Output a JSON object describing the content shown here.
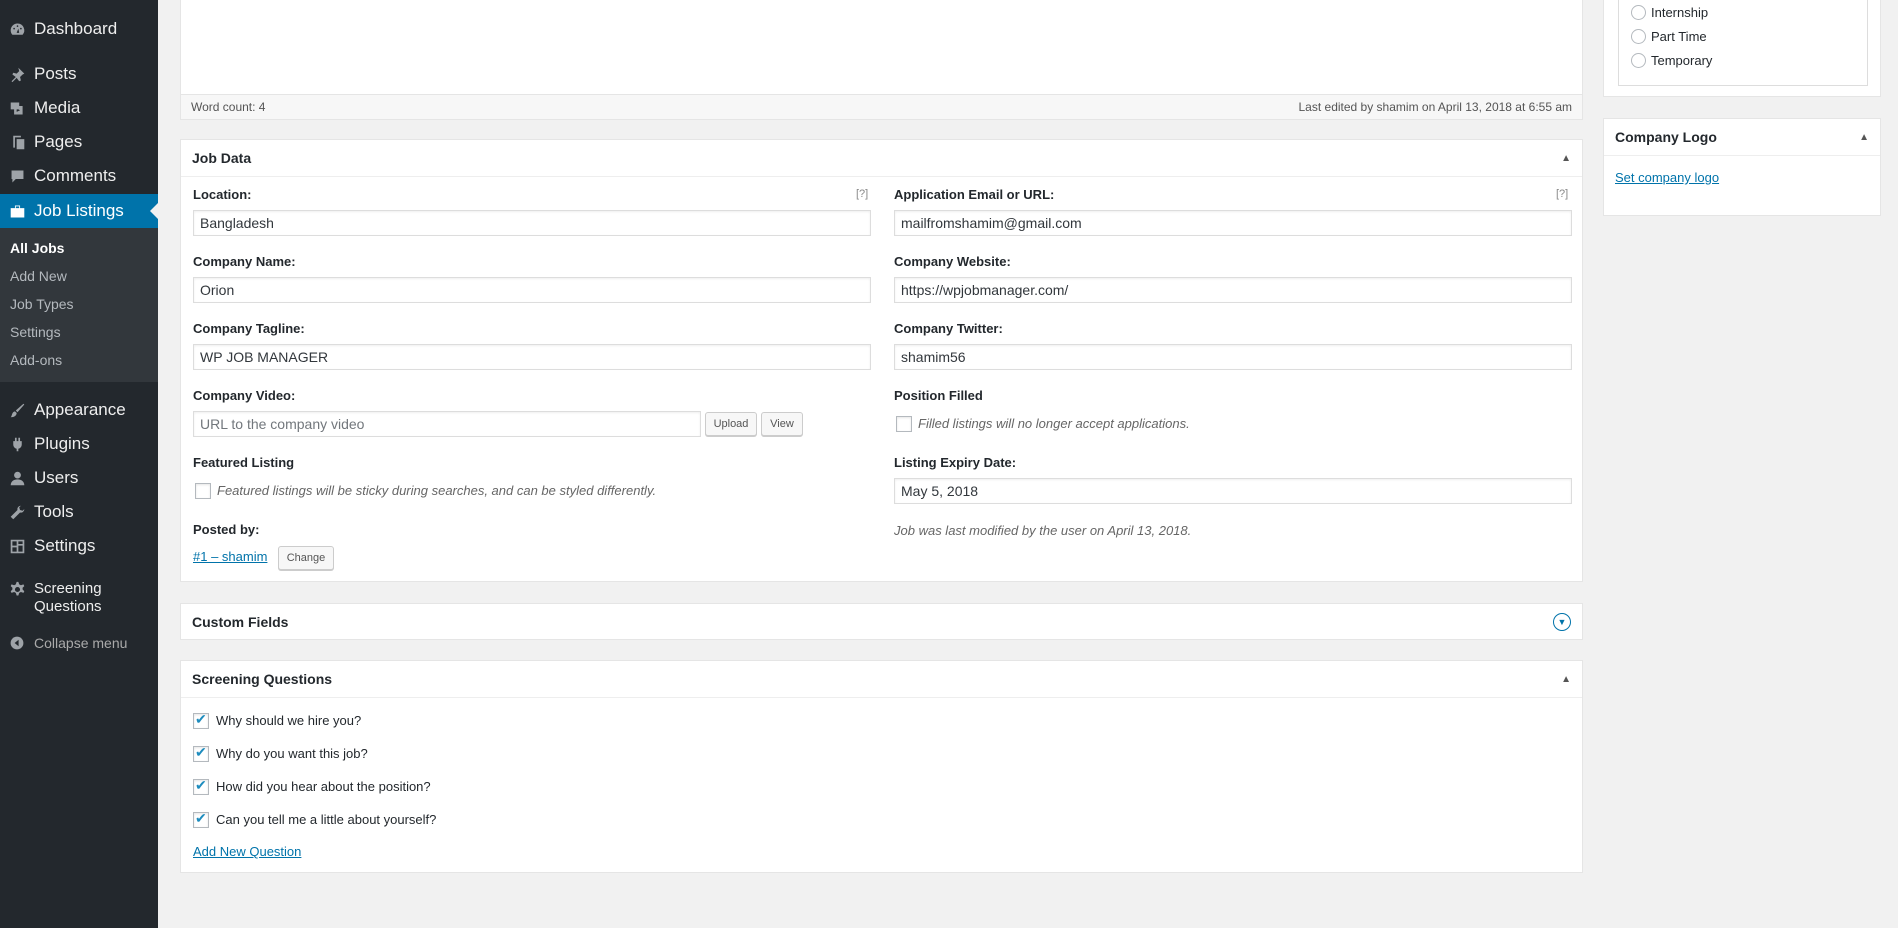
{
  "sidebar": {
    "items": [
      {
        "label": "Dashboard",
        "icon": "dashboard-icon"
      },
      {
        "label": "Posts",
        "icon": "pin-icon"
      },
      {
        "label": "Media",
        "icon": "media-icon"
      },
      {
        "label": "Pages",
        "icon": "pages-icon"
      },
      {
        "label": "Comments",
        "icon": "comment-icon"
      },
      {
        "label": "Job Listings",
        "icon": "briefcase-icon"
      },
      {
        "label": "Appearance",
        "icon": "brush-icon"
      },
      {
        "label": "Plugins",
        "icon": "plug-icon"
      },
      {
        "label": "Users",
        "icon": "user-icon"
      },
      {
        "label": "Tools",
        "icon": "wrench-icon"
      },
      {
        "label": "Settings",
        "icon": "settings-icon"
      },
      {
        "label": "Screening Questions",
        "icon": "gear-icon"
      }
    ],
    "submenu": [
      "All Jobs",
      "Add New",
      "Job Types",
      "Settings",
      "Add-ons"
    ],
    "collapse_label": "Collapse menu"
  },
  "editor": {
    "word_count": "Word count: 4",
    "last_edited": "Last edited by shamim on April 13, 2018 at 6:55 am"
  },
  "job_data": {
    "title": "Job Data",
    "help_mark": "[?]",
    "location": {
      "label": "Location:",
      "value": "Bangladesh"
    },
    "application": {
      "label": "Application Email or URL:",
      "value": "mailfromshamim@gmail.com"
    },
    "company_name": {
      "label": "Company Name:",
      "value": "Orion"
    },
    "company_website": {
      "label": "Company Website:",
      "value": "https://wpjobmanager.com/"
    },
    "company_tagline": {
      "label": "Company Tagline:",
      "value": "WP JOB MANAGER"
    },
    "company_twitter": {
      "label": "Company Twitter:",
      "value": "shamim56"
    },
    "company_video": {
      "label": "Company Video:",
      "placeholder": "URL to the company video",
      "upload_label": "Upload",
      "view_label": "View"
    },
    "position_filled": {
      "label": "Position Filled",
      "note": "Filled listings will no longer accept applications."
    },
    "featured": {
      "label": "Featured Listing",
      "note": "Featured listings will be sticky during searches, and can be styled differently."
    },
    "expiry": {
      "label": "Listing Expiry Date:",
      "value": "May 5, 2018"
    },
    "posted_by": {
      "label": "Posted by:",
      "user": "#1 – shamim",
      "change_label": "Change"
    },
    "modified_note": "Job was last modified by the user on April 13, 2018."
  },
  "custom_fields": {
    "title": "Custom Fields"
  },
  "screening": {
    "title": "Screening Questions",
    "questions": [
      "Why should we hire you?",
      "Why do you want this job?",
      "How did you hear about the position?",
      "Can you tell me a little about yourself?"
    ],
    "add_label": "Add New Question"
  },
  "job_types": [
    "Internship",
    "Part Time",
    "Temporary"
  ],
  "company_logo": {
    "title": "Company Logo",
    "link": "Set company logo"
  }
}
